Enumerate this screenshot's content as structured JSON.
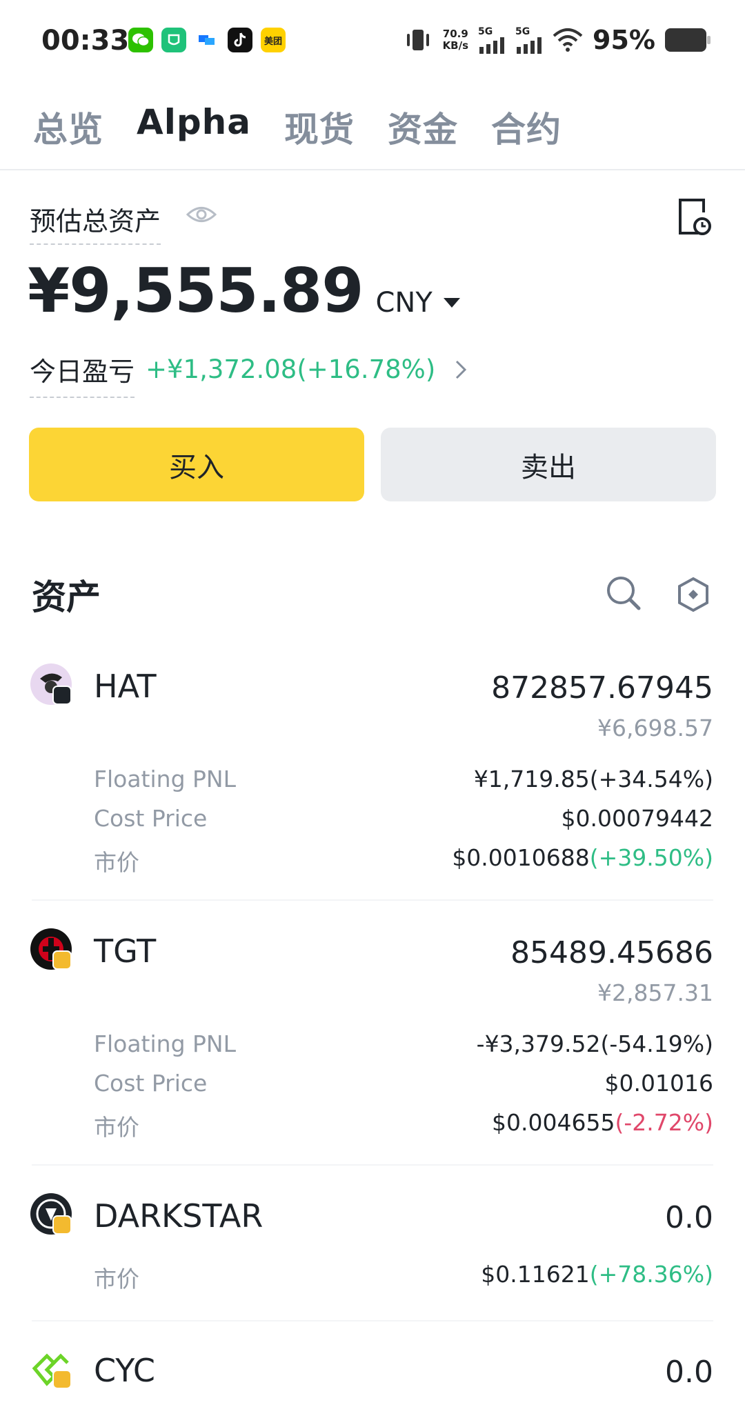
{
  "status_bar": {
    "time": "00:33",
    "net_speed_value": "70.9",
    "net_speed_unit": "KB/s",
    "signal1": "5G",
    "signal2": "5G",
    "battery": "95%",
    "apps": [
      "wechat-icon",
      "mini-icon",
      "message-icon",
      "tiktok-icon",
      "meituan-icon"
    ],
    "meituan_label": "美团"
  },
  "tabs": [
    {
      "label": "总览",
      "active": false
    },
    {
      "label": "Alpha",
      "active": true
    },
    {
      "label": "现货",
      "active": false
    },
    {
      "label": "资金",
      "active": false
    },
    {
      "label": "合约",
      "active": false
    }
  ],
  "summary": {
    "est_label": "预估总资产",
    "balance": "¥9,555.89",
    "currency": "CNY",
    "pnl_label": "今日盈亏",
    "pnl_value": "+¥1,372.08(+16.78%)"
  },
  "actions": {
    "buy": "买入",
    "sell": "卖出"
  },
  "assets": {
    "title": "资产",
    "items": [
      {
        "symbol": "HAT",
        "quantity": "872857.67945",
        "fiat": "¥6,698.57",
        "floating_label": "Floating PNL",
        "floating_value": "¥1,719.85(+34.54%)",
        "cost_label": "Cost Price",
        "cost_value": "$0.00079442",
        "price_label": "市价",
        "price_value": "$0.0010688",
        "price_change": "(+39.50%)"
      },
      {
        "symbol": "TGT",
        "quantity": "85489.45686",
        "fiat": "¥2,857.31",
        "floating_label": "Floating PNL",
        "floating_value": "-¥3,379.52(-54.19%)",
        "cost_label": "Cost Price",
        "cost_value": "$0.01016",
        "price_label": "市价",
        "price_value": "$0.004655",
        "price_change": "(-2.72%)"
      },
      {
        "symbol": "DARKSTAR",
        "quantity": "0.0",
        "price_label": "市价",
        "price_value": "$0.11621",
        "price_change": "(+78.36%)"
      },
      {
        "symbol": "CYC",
        "quantity": "0.0"
      }
    ]
  },
  "colors": {
    "accent_yellow": "#fcd535",
    "up_green": "#2ebd85",
    "down_red": "#e0476a"
  }
}
